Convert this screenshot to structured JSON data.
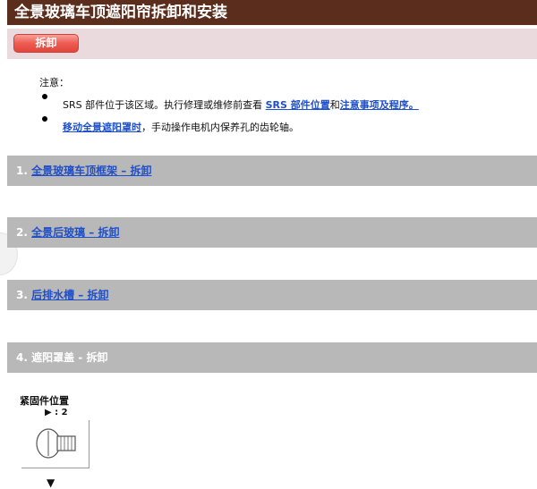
{
  "page": {
    "title": "全景玻璃车顶遮阳帘拆卸和安装"
  },
  "section": {
    "button_label": "拆卸"
  },
  "notes": {
    "label": "注意：",
    "line1_prefix": "SRS 部件位于该区域。执行修理或维修前查看 ",
    "line1_link1": "SRS 部件位置",
    "line1_mid": "和",
    "line1_link2": "注意事项及程序。",
    "line2_link": "移动全景遮阳罩时",
    "line2_suffix": "，手动操作电机内保养孔的齿轮轴。"
  },
  "steps": [
    {
      "number": "1.",
      "label": "全景玻璃车顶框架 – 拆卸",
      "is_link": true
    },
    {
      "number": "2.",
      "label": "全景后玻璃 – 拆卸",
      "is_link": true
    },
    {
      "number": "3.",
      "label": "后排水槽 – 拆卸",
      "is_link": true
    },
    {
      "number": "4.",
      "label": "遮阳罩盖 - 拆卸",
      "is_link": false
    }
  ],
  "fastener": {
    "title": "紧固件位置",
    "count": "▶ : 2"
  },
  "icons": {
    "screw": "screw-icon",
    "arrow": "down-arrow-icon"
  },
  "colors": {
    "title_bg": "#5a2d1c",
    "section_bg": "#ead9dd",
    "button_red": "#ef5b50",
    "step_bg": "#b8b8b8",
    "link": "#1f4fc9"
  }
}
